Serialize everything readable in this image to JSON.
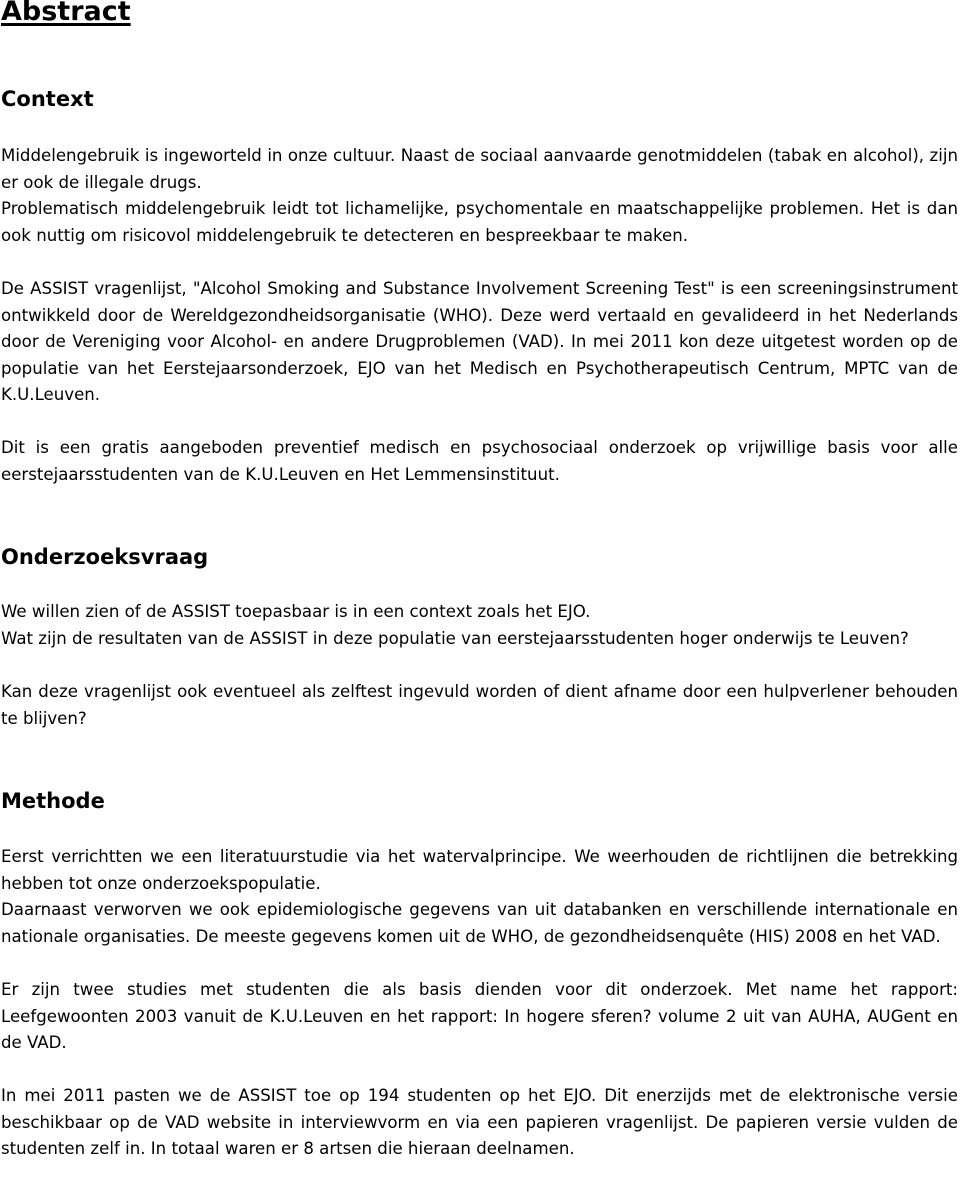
{
  "document": {
    "title": "Abstract",
    "sections": [
      {
        "heading": "Context",
        "paragraphs": [
          "Middelengebruik is ingeworteld in onze cultuur. Naast de sociaal aanvaarde genotmiddelen (tabak en alcohol), zijn er ook de illegale drugs.",
          "Problematisch middelengebruik leidt tot lichamelijke, psychomentale en maatschappelijke problemen. Het is dan ook nuttig om risicovol middelengebruik te detecteren en bespreekbaar te maken.",
          "De ASSIST vragenlijst, \"Alcohol Smoking and Substance Involvement Screening Test\" is een screeningsinstrument ontwikkeld door de Wereldgezondheidsorganisatie (WHO). Deze werd vertaald en gevalideerd in het Nederlands door de Vereniging voor Alcohol- en andere Drugproblemen (VAD). In mei 2011 kon deze uitgetest worden op de populatie van het Eerstejaarsonderzoek, EJO van het Medisch en Psychotherapeutisch Centrum, MPTC van de K.U.Leuven.",
          "Dit is een gratis aangeboden preventief medisch en psychosociaal onderzoek op vrijwillige basis voor alle eerstejaarsstudenten van de K.U.Leuven en Het Lemmensinstituut."
        ]
      },
      {
        "heading": "Onderzoeksvraag",
        "paragraphs": [
          "We willen zien of de ASSIST toepasbaar is in een context zoals het EJO.",
          "Wat zijn de resultaten van de ASSIST in deze populatie van eerstejaarsstudenten hoger onderwijs te Leuven?",
          "Kan deze vragenlijst ook eventueel als zelftest ingevuld worden of dient afname door een hulpverlener behouden te blijven?"
        ]
      },
      {
        "heading": "Methode",
        "paragraphs": [
          "Eerst verrichtten we een literatuurstudie via het watervalprincipe. We weerhouden de richtlijnen die betrekking hebben tot onze onderzoekspopulatie.",
          "Daarnaast verworven we ook epidemiologische gegevens van uit databanken en verschillende internationale en nationale organisaties. De meeste gegevens komen uit de WHO, de gezondheidsenquête (HIS) 2008 en het VAD.",
          "Er zijn twee studies met studenten die als basis dienden voor dit onderzoek. Met name het rapport: Leefgewoonten 2003 vanuit de K.U.Leuven en het rapport: In hogere sferen? volume 2 uit van AUHA, AUGent en de VAD.",
          "In mei 2011 pasten we de ASSIST toe op 194 studenten op het EJO. Dit enerzijds met de elektronische versie beschikbaar op de VAD website in interviewvorm en via een papieren vragenlijst. De papieren versie vulden de studenten zelf in. In totaal waren er 8 artsen die hieraan deelnamen."
        ]
      }
    ]
  }
}
